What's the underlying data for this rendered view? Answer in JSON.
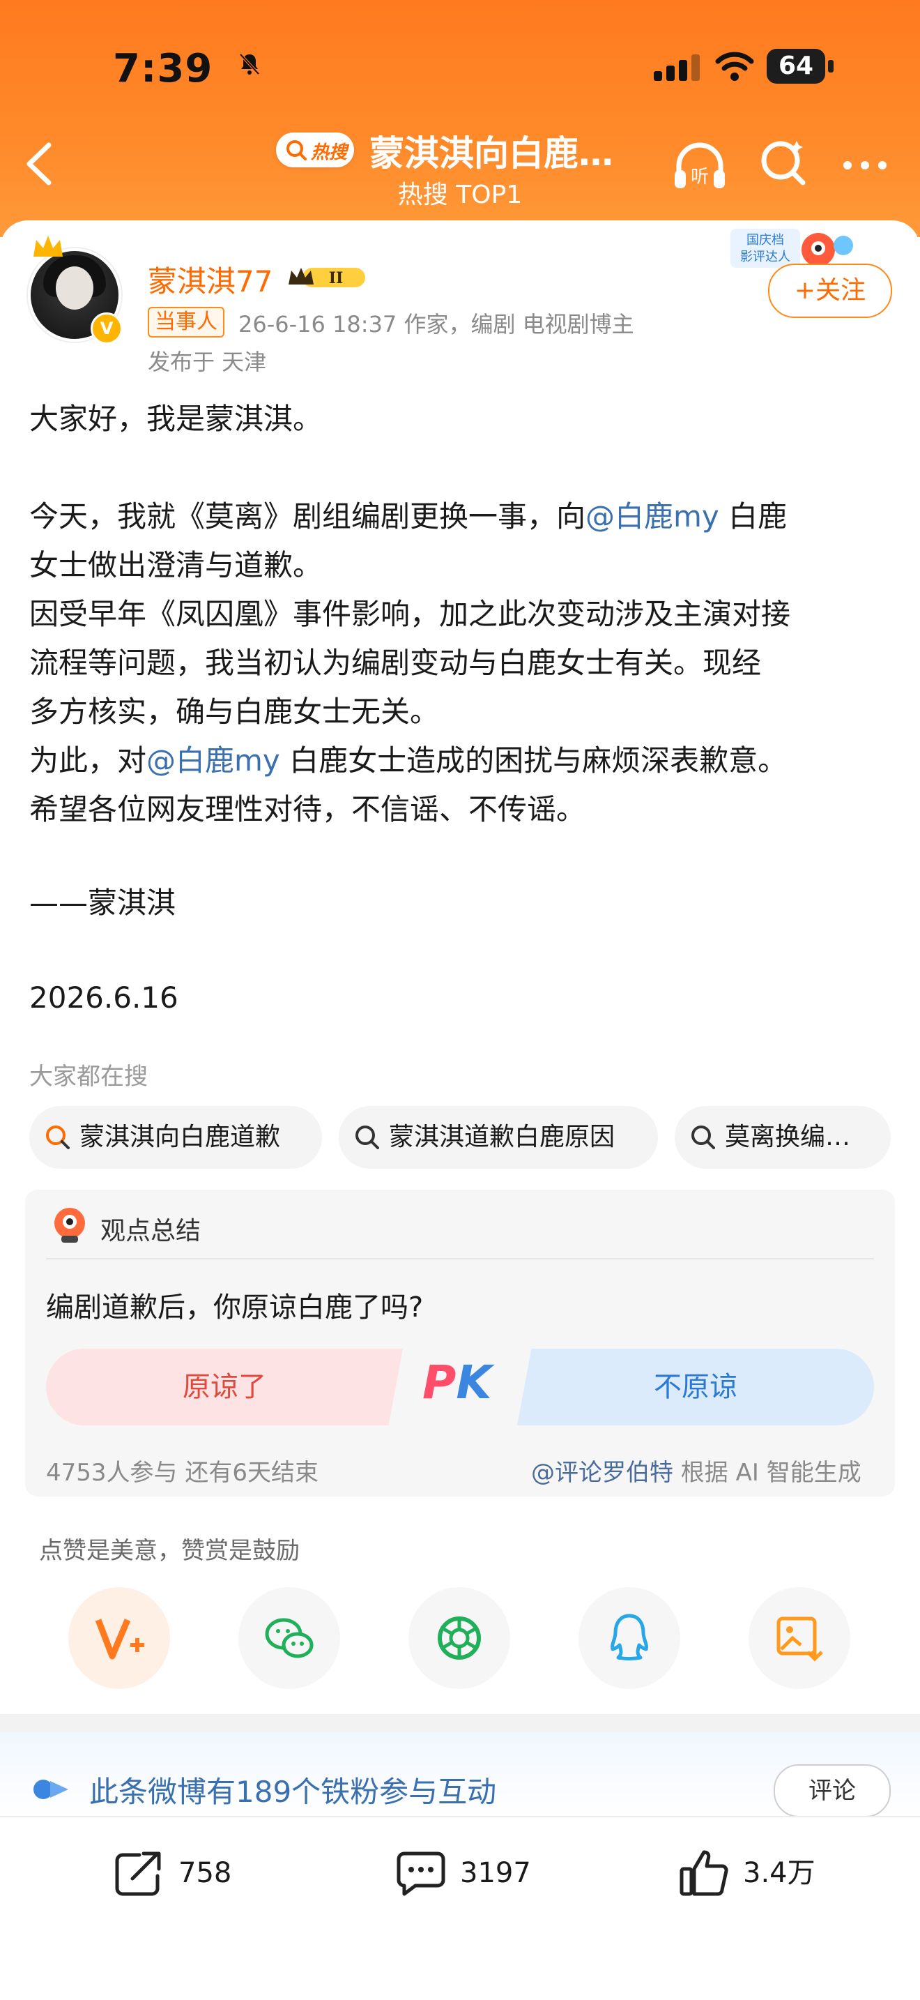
{
  "status_bar": {
    "time": "7:39",
    "battery": "64"
  },
  "header": {
    "hot_tag": "热搜",
    "title": "蒙淇淇向白鹿…",
    "subtitle": "热搜 TOP1"
  },
  "post": {
    "username": "蒙淇淇77",
    "level": "II",
    "party_tag": "当事人",
    "meta": "26-6-16 18:37  作家，编剧 电视剧博主",
    "location": "发布于 天津",
    "mascot_text": "国庆档\n影评达人",
    "follow_label": "+关注",
    "body": {
      "p1": "大家好，我是蒙淇淇。",
      "p2_pre": "今天，我就《莫离》剧组编剧更换一事，向",
      "mention1": "@白鹿my",
      "p2_post1": " 白鹿",
      "p2_post2": "女士做出澄清与道歉。",
      "p3_l1": "因受早年《凤囚凰》事件影响，加之此次变动涉及主演对接",
      "p3_l2": "流程等问题，我当初认为编剧变动与白鹿女士有关。现经",
      "p3_l3": "多方核实，确与白鹿女士无关。",
      "p4_pre": "为此，对",
      "mention2": "@白鹿my",
      "p4_post": " 白鹿女士造成的困扰与麻烦深表歉意。",
      "p5": "希望各位网友理性对待，不信谣、不传谣。",
      "signature": "——蒙淇淇",
      "date": "2026.6.16"
    }
  },
  "searches": {
    "label": "大家都在搜",
    "items": [
      "蒙淇淇向白鹿道歉",
      "蒙淇淇道歉白鹿原因",
      "莫离换编…"
    ]
  },
  "poll": {
    "header": "观点总结",
    "question": "编剧道歉后，你原谅白鹿了吗?",
    "option_yes": "原谅了",
    "pk_p": "P",
    "pk_k": "K",
    "option_no": "不原谅",
    "participants": "4753人参与   还有6天结束",
    "source_mention": "@评论罗伯特",
    "source_suffix": " 根据 AI 智能生成"
  },
  "reward_tip": "点赞是美意，赞赏是鼓励",
  "share_icons": [
    "v-plus-icon",
    "wechat-icon",
    "moments-icon",
    "qq-icon",
    "save-image-icon"
  ],
  "fans": {
    "text": "此条微博有189个铁粉参与互动",
    "comment_label": "评论"
  },
  "actions": {
    "repost": "758",
    "comments": "3197",
    "likes": "3.4万"
  },
  "colors": {
    "accent": "#ff6b00",
    "header_bg": "#ff7a1e",
    "link": "#3a6fb0"
  }
}
